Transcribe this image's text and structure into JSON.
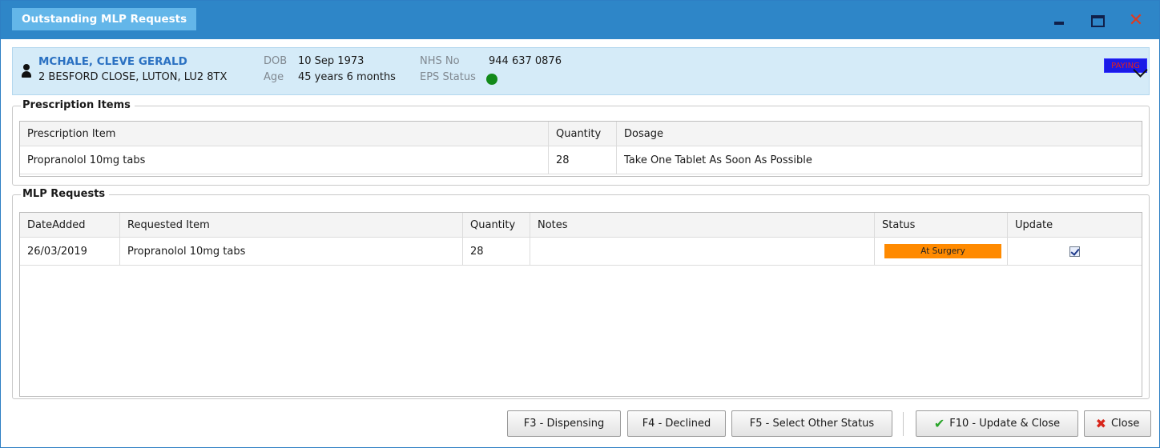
{
  "window": {
    "title": "Outstanding MLP Requests"
  },
  "patient": {
    "name": "MCHALE, CLEVE GERALD",
    "address": "2 BESFORD CLOSE, LUTON, LU2 8TX",
    "dob_label": "DOB",
    "dob": "10 Sep 1973",
    "age_label": "Age",
    "age": "45 years 6 months",
    "nhs_label": "NHS No",
    "nhs_no": "944 637 0876",
    "eps_label": "EPS Status",
    "eps_status_color": "#138a1a",
    "paying_badge": "PAYING"
  },
  "prescription": {
    "title": "Prescription Items",
    "columns": [
      "Prescription Item",
      "Quantity",
      "Dosage"
    ],
    "rows": [
      [
        "Propranolol 10mg tabs",
        "28",
        "Take One Tablet As Soon As Possible"
      ]
    ]
  },
  "mlp": {
    "title": "MLP Requests",
    "columns": [
      "DateAdded",
      "Requested Item",
      "Quantity",
      "Notes",
      "Status",
      "Update"
    ],
    "rows": [
      {
        "date": "26/03/2019",
        "item": "Propranolol 10mg tabs",
        "quantity": "28",
        "notes": "",
        "status": "At Surgery",
        "status_color": "#ff8a00",
        "update_checked": true
      }
    ]
  },
  "footer": {
    "dispensing": "F3 - Dispensing",
    "declined": "F4 - Declined",
    "other_status": "F5 - Select Other Status",
    "update_close": "F10 - Update & Close",
    "close": "Close"
  }
}
